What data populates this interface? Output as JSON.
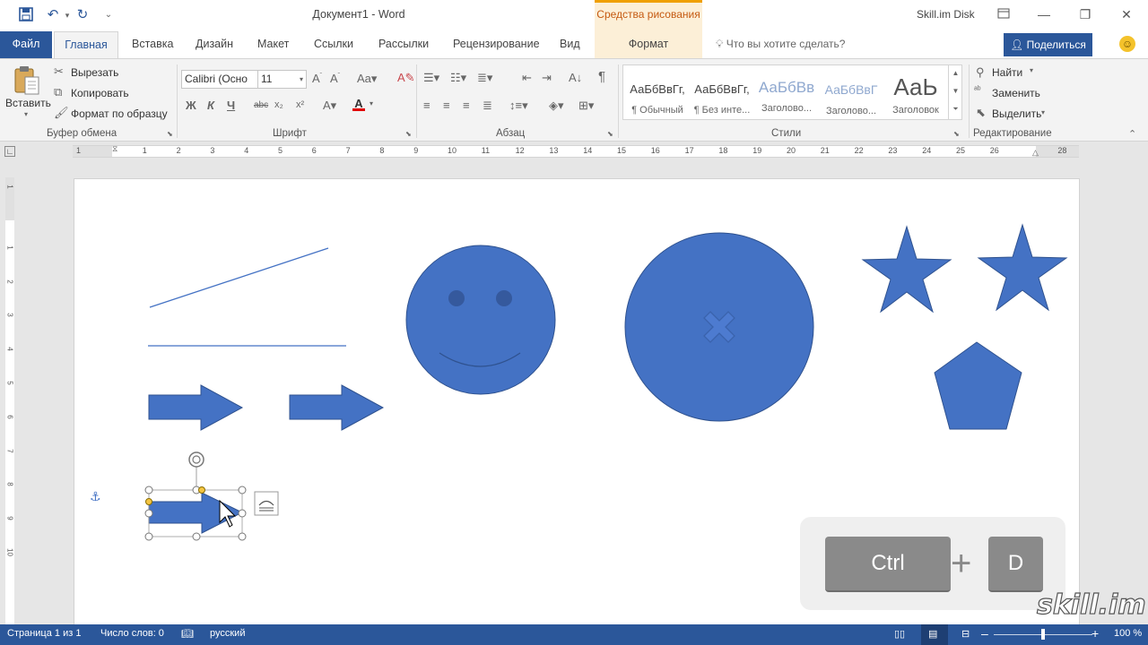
{
  "title_bar": {
    "document_title": "Документ1 - Word",
    "contextual_tab": "Средства рисования",
    "account": "Skill.im Disk"
  },
  "tabs": {
    "file": "Файл",
    "home": "Главная",
    "insert": "Вставка",
    "design": "Дизайн",
    "layout": "Макет",
    "references": "Ссылки",
    "mailings": "Рассылки",
    "review": "Рецензирование",
    "view": "Вид",
    "format": "Формат",
    "tell_me_placeholder": "Что вы хотите сделать?",
    "share": "Поделиться"
  },
  "clipboard": {
    "paste": "Вставить",
    "cut": "Вырезать",
    "copy": "Копировать",
    "format_painter": "Формат по образцу",
    "label": "Буфер обмена"
  },
  "font": {
    "name": "Calibri (Осно",
    "size": "11",
    "label": "Шрифт",
    "bold": "Ж",
    "italic": "К",
    "underline": "Ч",
    "strike": "abc"
  },
  "paragraph": {
    "label": "Абзац"
  },
  "styles": {
    "label": "Стили",
    "items": [
      {
        "sample": "АаБбВвГг,",
        "name": "¶ Обычный"
      },
      {
        "sample": "АаБбВвГг,",
        "name": "¶ Без инте..."
      },
      {
        "sample": "АаБбВв",
        "name": "Заголово..."
      },
      {
        "sample": "АаБбВвГ",
        "name": "Заголово..."
      },
      {
        "sample": "АаЬ",
        "name": "Заголовок"
      }
    ]
  },
  "editing": {
    "find": "Найти",
    "replace": "Заменить",
    "select": "Выделить",
    "label": "Редактирование"
  },
  "ruler": {
    "h_numbers": [
      "1",
      "1",
      "2",
      "3",
      "4",
      "5",
      "6",
      "7",
      "8",
      "9",
      "10",
      "11",
      "12",
      "13",
      "14",
      "15",
      "16",
      "17",
      "18",
      "19",
      "20",
      "21",
      "22",
      "23",
      "24",
      "25",
      "26",
      "28"
    ],
    "v_numbers": [
      "1",
      "1",
      "2",
      "3",
      "4",
      "5",
      "6",
      "7",
      "8",
      "9",
      "10"
    ]
  },
  "shortcut": {
    "key1": "Ctrl",
    "plus": "+",
    "key2": "D"
  },
  "watermark": "skill.im",
  "status_bar": {
    "page": "Страница 1 из 1",
    "words": "Число слов: 0",
    "language": "русский",
    "zoom": "100 %"
  },
  "colors": {
    "accent": "#2b579a",
    "shape_fill": "#4472c4",
    "shape_outline": "#2f528f",
    "contextual_tab": "#c55a11"
  }
}
